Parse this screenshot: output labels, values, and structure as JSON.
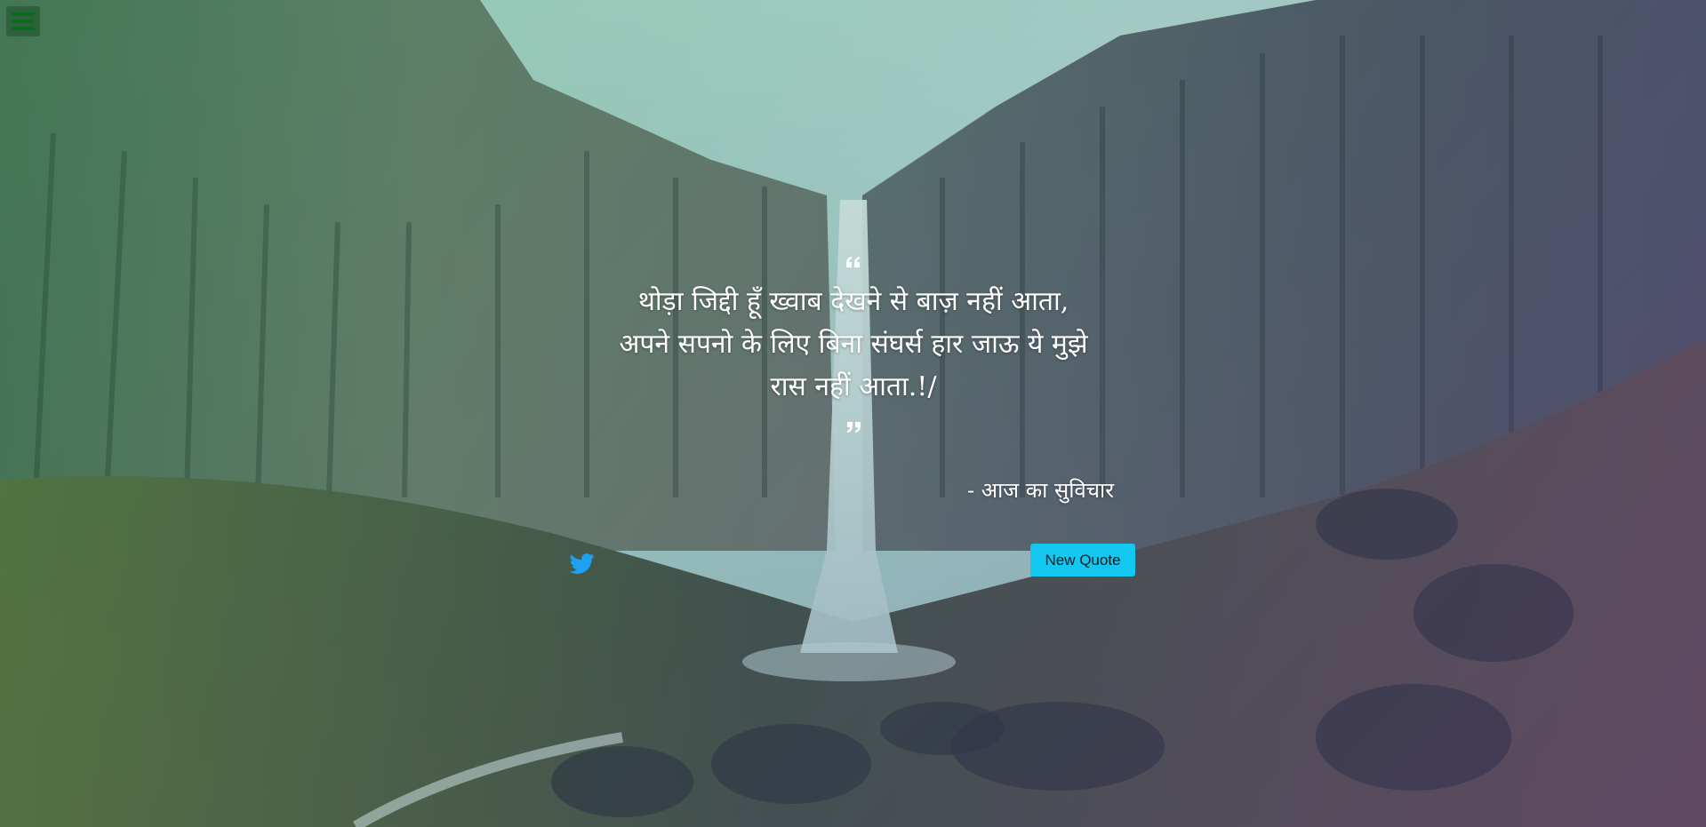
{
  "quote": {
    "text_lines": [
      "थोड़ा जिद्दी हूँ ख्वाब देखने से बाज़ नहीं आता,",
      "अपने सपनो के लिए बिना संघर्स हार जाऊ ये मुझे",
      "रास नहीं आता.!/"
    ],
    "author": "- आज का सुविचार"
  },
  "actions": {
    "new_quote_label": "New Quote"
  },
  "icons": {
    "menu": "hamburger-menu-icon",
    "tweet": "twitter-icon",
    "quote_open": "quote-left-icon",
    "quote_close": "quote-right-icon"
  },
  "colors": {
    "accent": "#14c7ef",
    "menu_icon": "#0a6b1e",
    "twitter": "#1da1f2",
    "text": "#ffffff"
  }
}
